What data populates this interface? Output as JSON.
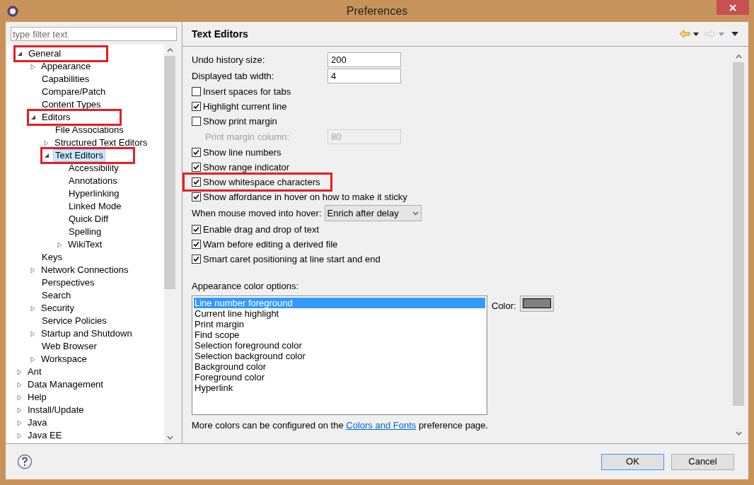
{
  "window": {
    "title": "Preferences"
  },
  "filter": {
    "placeholder": "type filter text"
  },
  "tree": [
    {
      "label": "General",
      "kind": "node",
      "expanded": true,
      "selected": false,
      "marked": true,
      "children": [
        {
          "label": "Appearance",
          "kind": "node",
          "expanded": false,
          "selected": false,
          "marked": false
        },
        {
          "label": "Capabilities",
          "kind": "leaf",
          "selected": false,
          "marked": false
        },
        {
          "label": "Compare/Patch",
          "kind": "leaf",
          "selected": false,
          "marked": false
        },
        {
          "label": "Content Types",
          "kind": "leaf",
          "selected": false,
          "marked": false
        },
        {
          "label": "Editors",
          "kind": "node",
          "expanded": true,
          "selected": false,
          "marked": true,
          "children": [
            {
              "label": "File Associations",
              "kind": "leaf",
              "selected": false,
              "marked": false
            },
            {
              "label": "Structured Text Editors",
              "kind": "node",
              "expanded": false,
              "selected": false,
              "marked": false
            },
            {
              "label": "Text Editors",
              "kind": "node",
              "expanded": true,
              "selected": true,
              "marked": true,
              "children": [
                {
                  "label": "Accessibility",
                  "kind": "leaf",
                  "selected": false,
                  "marked": false
                },
                {
                  "label": "Annotations",
                  "kind": "leaf",
                  "selected": false,
                  "marked": false
                },
                {
                  "label": "Hyperlinking",
                  "kind": "leaf",
                  "selected": false,
                  "marked": false
                },
                {
                  "label": "Linked Mode",
                  "kind": "leaf",
                  "selected": false,
                  "marked": false
                },
                {
                  "label": "Quick Diff",
                  "kind": "leaf",
                  "selected": false,
                  "marked": false
                },
                {
                  "label": "Spelling",
                  "kind": "leaf",
                  "selected": false,
                  "marked": false
                },
                {
                  "label": "WikiText",
                  "kind": "node",
                  "expanded": false,
                  "selected": false,
                  "marked": false
                }
              ]
            }
          ]
        },
        {
          "label": "Keys",
          "kind": "leaf",
          "selected": false,
          "marked": false
        },
        {
          "label": "Network Connections",
          "kind": "node",
          "expanded": false,
          "selected": false,
          "marked": false
        },
        {
          "label": "Perspectives",
          "kind": "leaf",
          "selected": false,
          "marked": false
        },
        {
          "label": "Search",
          "kind": "leaf",
          "selected": false,
          "marked": false
        },
        {
          "label": "Security",
          "kind": "node",
          "expanded": false,
          "selected": false,
          "marked": false
        },
        {
          "label": "Service Policies",
          "kind": "leaf",
          "selected": false,
          "marked": false
        },
        {
          "label": "Startup and Shutdown",
          "kind": "node",
          "expanded": false,
          "selected": false,
          "marked": false
        },
        {
          "label": "Web Browser",
          "kind": "leaf",
          "selected": false,
          "marked": false
        },
        {
          "label": "Workspace",
          "kind": "node",
          "expanded": false,
          "selected": false,
          "marked": false
        }
      ]
    },
    {
      "label": "Ant",
      "kind": "node",
      "expanded": false,
      "selected": false,
      "marked": false
    },
    {
      "label": "Data Management",
      "kind": "node",
      "expanded": false,
      "selected": false,
      "marked": false
    },
    {
      "label": "Help",
      "kind": "node",
      "expanded": false,
      "selected": false,
      "marked": false
    },
    {
      "label": "Install/Update",
      "kind": "node",
      "expanded": false,
      "selected": false,
      "marked": false
    },
    {
      "label": "Java",
      "kind": "node",
      "expanded": false,
      "selected": false,
      "marked": false
    },
    {
      "label": "Java EE",
      "kind": "node",
      "expanded": false,
      "selected": false,
      "marked": false
    }
  ],
  "page": {
    "title": "Text Editors",
    "settings": [
      {
        "kind": "text_field",
        "label": "Undo history size:",
        "value": "200",
        "disabled": false
      },
      {
        "kind": "text_field",
        "label": "Displayed tab width:",
        "value": "4",
        "disabled": false
      },
      {
        "kind": "checkbox",
        "label": "Insert spaces for tabs",
        "checked": false,
        "marked": false
      },
      {
        "kind": "checkbox",
        "label": "Highlight current line",
        "checked": true,
        "marked": false
      },
      {
        "kind": "checkbox",
        "label": "Show print margin",
        "checked": false,
        "marked": false
      },
      {
        "kind": "text_field",
        "label": "Print margin column:",
        "value": "80",
        "disabled": true
      },
      {
        "kind": "checkbox",
        "label": "Show line numbers",
        "checked": true,
        "marked": false
      },
      {
        "kind": "checkbox",
        "label": "Show range indicator",
        "checked": true,
        "marked": false
      },
      {
        "kind": "checkbox",
        "label": "Show whitespace characters",
        "checked": true,
        "marked": true
      },
      {
        "kind": "checkbox",
        "label": "Show affordance in hover on how to make it sticky",
        "checked": true,
        "marked": false
      },
      {
        "kind": "combo",
        "label": "When mouse moved into hover:",
        "value": "Enrich after delay"
      },
      {
        "kind": "checkbox",
        "label": "Enable drag and drop of text",
        "checked": true,
        "marked": false
      },
      {
        "kind": "checkbox",
        "label": "Warn before editing a derived file",
        "checked": true,
        "marked": false
      },
      {
        "kind": "checkbox",
        "label": "Smart caret positioning at line start and end",
        "checked": true,
        "marked": false
      }
    ],
    "color_options": {
      "label": "Appearance color options:",
      "items": [
        {
          "label": "Line number foreground",
          "selected": true
        },
        {
          "label": "Current line highlight",
          "selected": false
        },
        {
          "label": "Print margin",
          "selected": false
        },
        {
          "label": "Find scope",
          "selected": false
        },
        {
          "label": "Selection foreground color",
          "selected": false
        },
        {
          "label": "Selection background color",
          "selected": false
        },
        {
          "label": "Background color",
          "selected": false
        },
        {
          "label": "Foreground color",
          "selected": false
        },
        {
          "label": "Hyperlink",
          "selected": false
        }
      ],
      "color_label": "Color:",
      "color": "#808080"
    },
    "footer": {
      "before": "More colors can be configured on the",
      "link": "Colors and Fonts",
      "after": "preference page."
    }
  },
  "buttons": [
    "OK",
    "Cancel"
  ]
}
